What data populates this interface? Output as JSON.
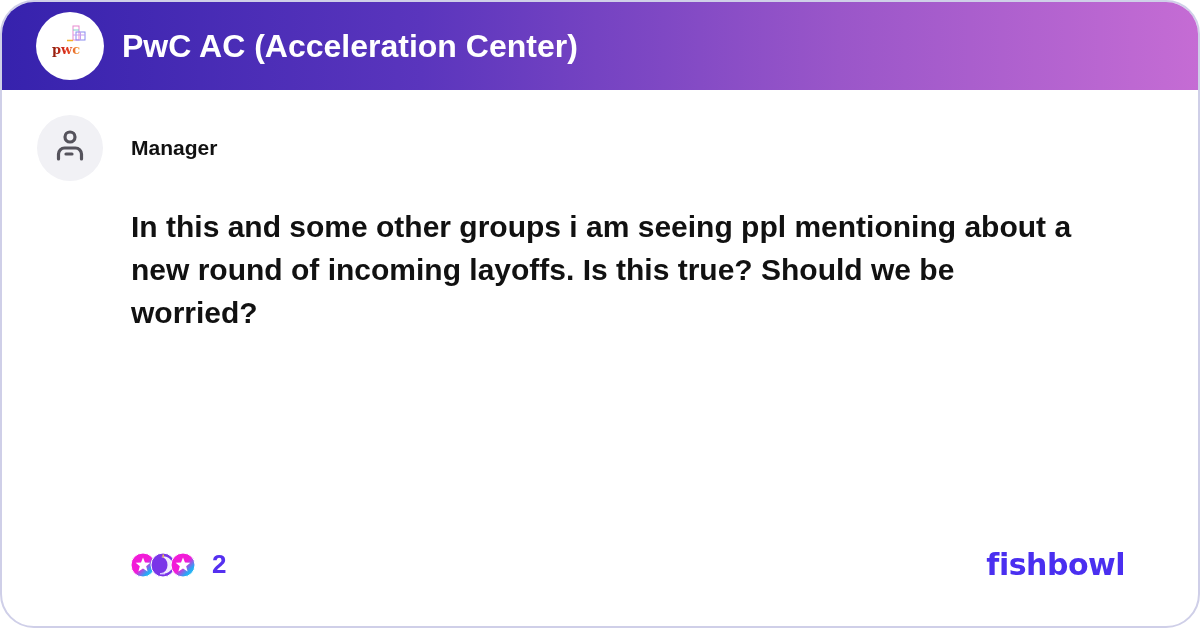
{
  "header": {
    "logo_text": "pwc",
    "group_name": "PwC AC (Acceleration Center)"
  },
  "post": {
    "author": "Manager",
    "body": "In this and some other groups i am seeing ppl mentioning about a new round of incoming layoffs. Is this true? Should we be worried?"
  },
  "footer": {
    "reaction_count": "2",
    "brand": "fishbowl"
  }
}
